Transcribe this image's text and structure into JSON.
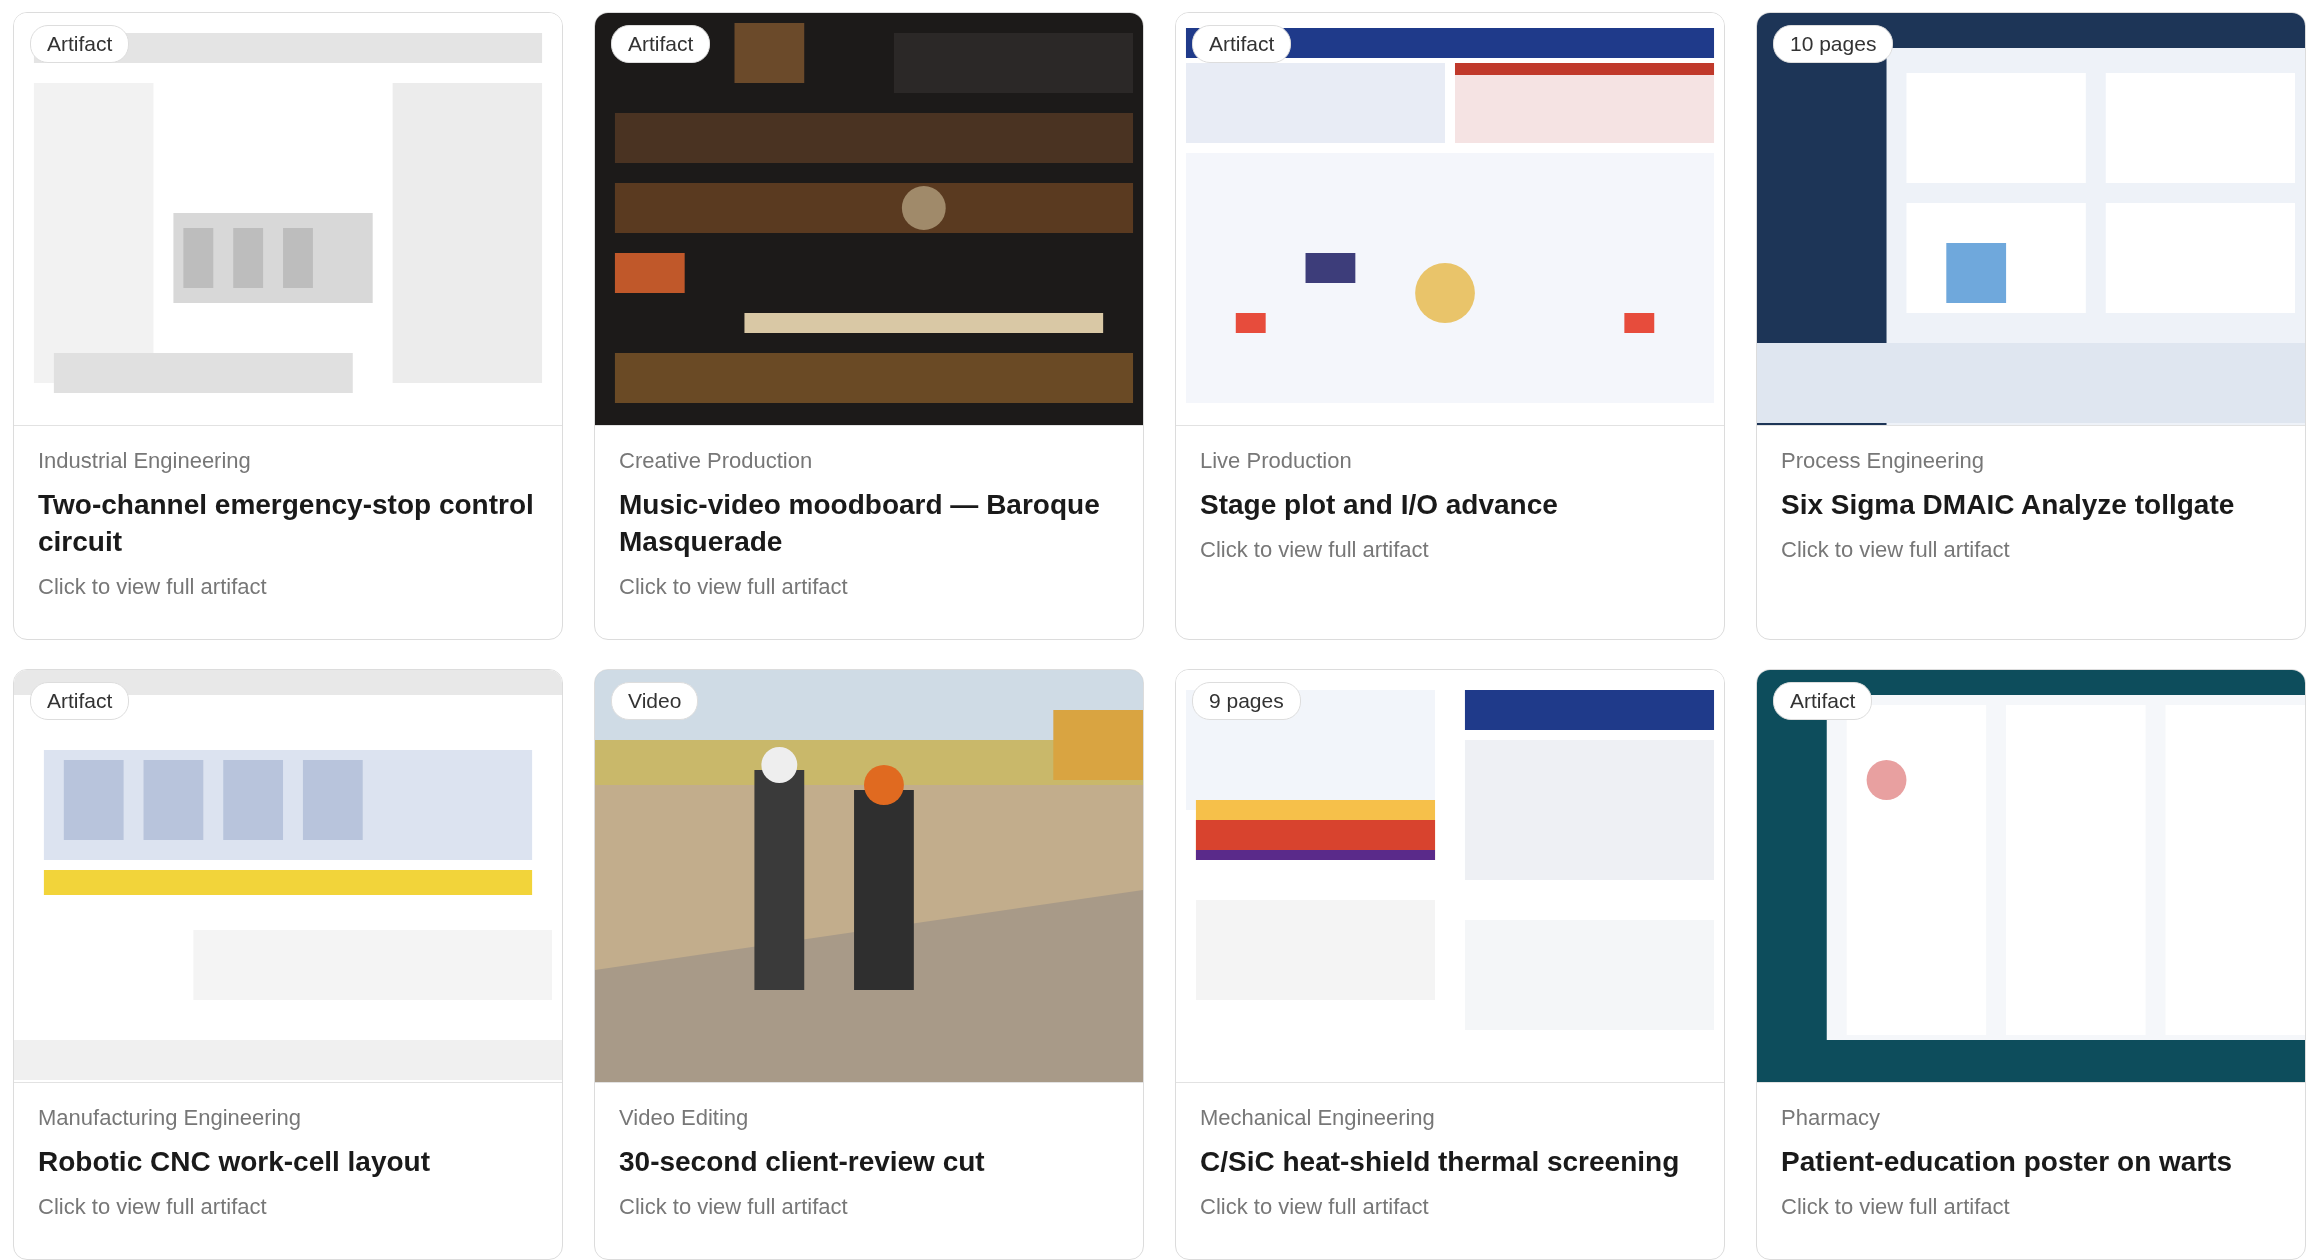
{
  "cards": [
    {
      "badge": "Artifact",
      "category": "Industrial Engineering",
      "title": "Two-channel emergency-stop control circuit",
      "link": "Click to view full artifact"
    },
    {
      "badge": "Artifact",
      "category": "Creative Production",
      "title": "Music-video moodboard — Baroque Masquerade",
      "link": "Click to view full artifact"
    },
    {
      "badge": "Artifact",
      "category": "Live Production",
      "title": "Stage plot and I/O advance",
      "link": "Click to view full artifact"
    },
    {
      "badge": "10 pages",
      "category": "Process Engineering",
      "title": "Six Sigma DMAIC Analyze tollgate",
      "link": "Click to view full artifact"
    },
    {
      "badge": "Artifact",
      "category": "Manufacturing Engineering",
      "title": "Robotic CNC work-cell layout",
      "link": "Click to view full artifact"
    },
    {
      "badge": "Video",
      "category": "Video Editing",
      "title": "30-second client-review cut",
      "link": "Click to view full artifact"
    },
    {
      "badge": "9 pages",
      "category": "Mechanical Engineering",
      "title": "C/SiC heat-shield thermal screening",
      "link": "Click to view full artifact"
    },
    {
      "badge": "Artifact",
      "category": "Pharmacy",
      "title": "Patient-education poster on warts",
      "link": "Click to view full artifact"
    }
  ]
}
